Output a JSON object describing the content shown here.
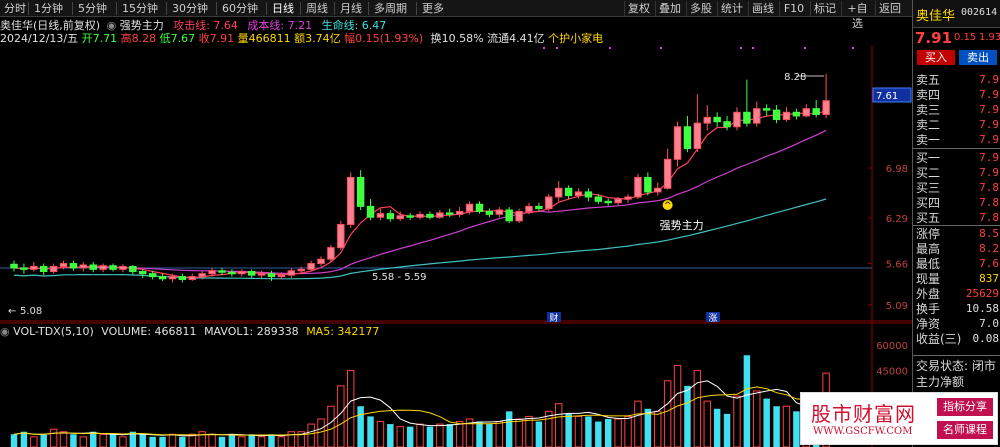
{
  "toolbar": {
    "periods": [
      "分时",
      "1分钟",
      "5分钟",
      "15分钟",
      "30分钟",
      "60分钟",
      "日线",
      "周线",
      "月线",
      "多周期",
      "更多"
    ],
    "active_period": "日线",
    "buttons": [
      "复权",
      "叠加",
      "多股",
      "统计",
      "画线",
      "F10",
      "标记",
      "+自选",
      "返回"
    ]
  },
  "info": {
    "stock_name": "奥佳华(日线,前复权)",
    "indicator_name": "强势主力",
    "attack_line_label": "攻击线: 7.64",
    "cost_line_label": "成本线: 7.21",
    "life_line_label": "生命线: 6.47",
    "date": "2024/12/13/五",
    "open": "开7.71",
    "high": "高8.28",
    "low": "低7.67",
    "close": "收7.91",
    "volume": "量466811",
    "amount": "额3.74亿",
    "change": "幅0.15(1.93%)",
    "turnover": "换10.58%",
    "float": "流通4.41亿",
    "holder": "个护小家电"
  },
  "vol_info": {
    "title": "VOL-TDX(5,10)",
    "volume": "VOLUME: 466811",
    "mavol1": "MAVOL1: 289338",
    "ma5": "MA5: 342177"
  },
  "chart_data": {
    "type": "candlestick",
    "price_axis_labels": [
      "6.98",
      "6.29",
      "5.66",
      "5.09"
    ],
    "current_price_label": "7.61",
    "annotations": {
      "high_mark": "8.28",
      "low_mark": "5.08",
      "range_mark": "5.58 - 5.59",
      "signal_label": "强势主力",
      "cai_tag": "财",
      "zhang_tag": "涨"
    },
    "vol_axis_labels": [
      "60000",
      "45000"
    ],
    "candles": [
      [
        5.65,
        5.6,
        5.7,
        5.55
      ],
      [
        5.6,
        5.58,
        5.66,
        5.52
      ],
      [
        5.58,
        5.62,
        5.68,
        5.55
      ],
      [
        5.62,
        5.55,
        5.66,
        5.5
      ],
      [
        5.55,
        5.62,
        5.66,
        5.52
      ],
      [
        5.62,
        5.66,
        5.7,
        5.58
      ],
      [
        5.66,
        5.6,
        5.7,
        5.56
      ],
      [
        5.6,
        5.64,
        5.68,
        5.55
      ],
      [
        5.64,
        5.58,
        5.68,
        5.54
      ],
      [
        5.58,
        5.63,
        5.66,
        5.54
      ],
      [
        5.63,
        5.58,
        5.66,
        5.55
      ],
      [
        5.58,
        5.62,
        5.65,
        5.54
      ],
      [
        5.62,
        5.55,
        5.64,
        5.5
      ],
      [
        5.55,
        5.52,
        5.58,
        5.46
      ],
      [
        5.52,
        5.48,
        5.56,
        5.44
      ],
      [
        5.48,
        5.45,
        5.52,
        5.42
      ],
      [
        5.45,
        5.48,
        5.52,
        5.4
      ],
      [
        5.48,
        5.44,
        5.52,
        5.4
      ],
      [
        5.44,
        5.48,
        5.52,
        5.42
      ],
      [
        5.48,
        5.52,
        5.55,
        5.44
      ],
      [
        5.52,
        5.56,
        5.6,
        5.48
      ],
      [
        5.56,
        5.54,
        5.6,
        5.5
      ],
      [
        5.54,
        5.52,
        5.58,
        5.48
      ],
      [
        5.52,
        5.55,
        5.58,
        5.48
      ],
      [
        5.55,
        5.5,
        5.58,
        5.46
      ],
      [
        5.5,
        5.52,
        5.56,
        5.46
      ],
      [
        5.52,
        5.48,
        5.56,
        5.42
      ],
      [
        5.48,
        5.5,
        5.54,
        5.44
      ],
      [
        5.5,
        5.56,
        5.6,
        5.46
      ],
      [
        5.56,
        5.58,
        5.62,
        5.52
      ],
      [
        5.58,
        5.66,
        5.7,
        5.55
      ],
      [
        5.66,
        5.72,
        5.76,
        5.62
      ],
      [
        5.72,
        5.88,
        5.92,
        5.68
      ],
      [
        5.88,
        6.2,
        6.25,
        5.85
      ],
      [
        6.2,
        6.85,
        6.92,
        6.15
      ],
      [
        6.85,
        6.45,
        6.95,
        6.4
      ],
      [
        6.45,
        6.3,
        6.55,
        6.26
      ],
      [
        6.3,
        6.35,
        6.42,
        6.26
      ],
      [
        6.35,
        6.28,
        6.4,
        6.24
      ],
      [
        6.28,
        6.32,
        6.38,
        6.25
      ],
      [
        6.32,
        6.3,
        6.36,
        6.26
      ],
      [
        6.3,
        6.34,
        6.38,
        6.27
      ],
      [
        6.34,
        6.3,
        6.38,
        6.27
      ],
      [
        6.3,
        6.36,
        6.4,
        6.28
      ],
      [
        6.36,
        6.34,
        6.42,
        6.3
      ],
      [
        6.34,
        6.38,
        6.44,
        6.3
      ],
      [
        6.38,
        6.48,
        6.52,
        6.34
      ],
      [
        6.48,
        6.38,
        6.52,
        6.35
      ],
      [
        6.38,
        6.34,
        6.42,
        6.3
      ],
      [
        6.34,
        6.4,
        6.44,
        6.3
      ],
      [
        6.4,
        6.25,
        6.44,
        6.22
      ],
      [
        6.25,
        6.38,
        6.42,
        6.22
      ],
      [
        6.38,
        6.45,
        6.5,
        6.34
      ],
      [
        6.45,
        6.42,
        6.5,
        6.38
      ],
      [
        6.42,
        6.58,
        6.62,
        6.38
      ],
      [
        6.58,
        6.7,
        6.8,
        6.52
      ],
      [
        6.7,
        6.6,
        6.74,
        6.55
      ],
      [
        6.6,
        6.65,
        6.7,
        6.56
      ],
      [
        6.65,
        6.58,
        6.7,
        6.52
      ],
      [
        6.58,
        6.52,
        6.62,
        6.48
      ],
      [
        6.52,
        6.5,
        6.56,
        6.46
      ],
      [
        6.5,
        6.55,
        6.58,
        6.46
      ],
      [
        6.55,
        6.58,
        6.62,
        6.5
      ],
      [
        6.58,
        6.85,
        6.9,
        6.55
      ],
      [
        6.85,
        6.65,
        6.92,
        6.6
      ],
      [
        6.65,
        6.7,
        6.78,
        6.6
      ],
      [
        6.7,
        7.1,
        7.25,
        6.68
      ],
      [
        7.1,
        7.55,
        7.62,
        7.0
      ],
      [
        7.55,
        7.25,
        7.7,
        7.2
      ],
      [
        7.25,
        7.6,
        8.0,
        7.2
      ],
      [
        7.6,
        7.68,
        7.85,
        7.5
      ],
      [
        7.68,
        7.62,
        7.75,
        7.55
      ],
      [
        7.62,
        7.55,
        7.7,
        7.5
      ],
      [
        7.55,
        7.75,
        7.82,
        7.5
      ],
      [
        7.75,
        7.6,
        8.2,
        7.55
      ],
      [
        7.6,
        7.8,
        7.9,
        7.55
      ],
      [
        7.8,
        7.78,
        7.86,
        7.7
      ],
      [
        7.78,
        7.65,
        7.85,
        7.6
      ],
      [
        7.65,
        7.75,
        7.82,
        7.62
      ],
      [
        7.75,
        7.7,
        7.8,
        7.65
      ],
      [
        7.7,
        7.8,
        7.86,
        7.68
      ],
      [
        7.8,
        7.72,
        7.92,
        7.68
      ],
      [
        7.72,
        7.91,
        8.28,
        7.67
      ]
    ],
    "volumes": [
      5,
      6,
      4,
      5,
      7,
      6,
      5,
      4,
      6,
      5,
      5,
      4,
      6,
      5,
      4,
      4,
      5,
      4,
      5,
      6,
      5,
      4,
      5,
      4,
      5,
      4,
      5,
      4,
      6,
      6,
      9,
      11,
      16,
      24,
      30,
      16,
      12,
      10,
      9,
      8,
      8,
      9,
      8,
      9,
      9,
      10,
      11,
      10,
      9,
      10,
      14,
      11,
      12,
      10,
      14,
      17,
      13,
      12,
      12,
      10,
      11,
      11,
      12,
      18,
      15,
      14,
      26,
      32,
      24,
      30,
      18,
      15,
      13,
      20,
      36,
      22,
      19,
      16,
      16,
      14,
      15,
      17,
      29
    ]
  },
  "panel": {
    "stock_name": "奥佳华",
    "stock_code": "002614",
    "price": "7.91",
    "change": "0.15",
    "pct": "1.93",
    "buy_btn": "买入",
    "sell_btn": "卖出",
    "asks": [
      {
        "label": "卖五",
        "value": "7.9"
      },
      {
        "label": "卖四",
        "value": "7.9"
      },
      {
        "label": "卖三",
        "value": "7.9"
      },
      {
        "label": "卖二",
        "value": "7.9"
      },
      {
        "label": "卖一",
        "value": "7.9"
      }
    ],
    "bids": [
      {
        "label": "买一",
        "value": "7.9"
      },
      {
        "label": "买二",
        "value": "7.9"
      },
      {
        "label": "买三",
        "value": "7.8"
      },
      {
        "label": "买四",
        "value": "7.8"
      },
      {
        "label": "买五",
        "value": "7.8"
      }
    ],
    "stats": [
      {
        "label": "涨停",
        "value": "8.5",
        "color": "#ff4040"
      },
      {
        "label": "最高",
        "value": "8.2",
        "color": "#ff4040"
      },
      {
        "label": "最低",
        "value": "7.6",
        "color": "#ff4040"
      },
      {
        "label": "现量",
        "value": "837",
        "color": "#ffd700"
      },
      {
        "label": "外盘",
        "value": "25629",
        "color": "#ff4040"
      },
      {
        "label": "换手",
        "value": "10.58",
        "color": "#e0e0e0"
      },
      {
        "label": "净资",
        "value": "7.0",
        "color": "#e0e0e0"
      },
      {
        "label": "收益(三)",
        "value": "0.08",
        "color": "#e0e0e0"
      }
    ],
    "trade_status": "交易状态: 闭市",
    "main_net": "主力净额"
  },
  "watermark": {
    "site_name": "股市财富网",
    "site_url": "WWW.GSCFW.COM",
    "tag1": "指标分享",
    "tag2": "名师课程"
  }
}
